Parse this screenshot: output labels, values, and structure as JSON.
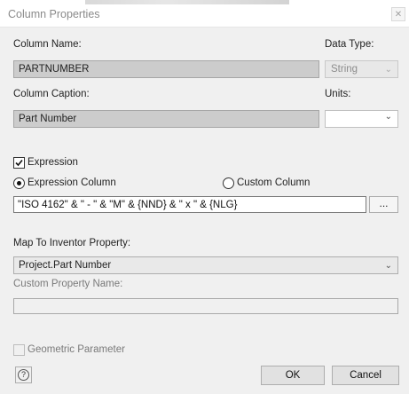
{
  "window": {
    "title": "Column Properties",
    "close_glyph": "✕"
  },
  "column_name": {
    "label": "Column Name:",
    "value": "PARTNUMBER"
  },
  "data_type": {
    "label": "Data Type:",
    "value": "String"
  },
  "column_caption": {
    "label": "Column Caption:",
    "value": "Part Number"
  },
  "units": {
    "label": "Units:",
    "value": ""
  },
  "expression_checkbox": {
    "label": "Expression",
    "checked": true
  },
  "column_mode": {
    "expression_label": "Expression Column",
    "custom_label": "Custom Column",
    "selected": "expression"
  },
  "expression": {
    "value": "\"ISO 4162\" & \" - \" & \"M\" & {NND} & \" x \" & {NLG}",
    "browse_label": "..."
  },
  "map_property": {
    "label": "Map To Inventor Property:",
    "value": "Project.Part Number"
  },
  "custom_property": {
    "label": "Custom Property Name:",
    "value": ""
  },
  "geometric_parameter": {
    "label": "Geometric Parameter",
    "checked": false
  },
  "buttons": {
    "help_glyph": "?",
    "ok_label": "OK",
    "cancel_label": "Cancel"
  },
  "icons": {
    "dropdown": "chevron-down-icon",
    "close": "close-icon",
    "help": "help-icon",
    "check": "checkmark-icon"
  }
}
